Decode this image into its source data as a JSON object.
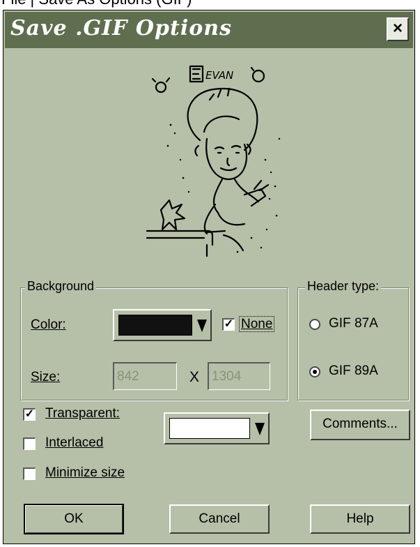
{
  "caption": "File | Save As Options (GIF)",
  "window": {
    "title": "Save .GIF Options",
    "close_glyph": "×"
  },
  "background": {
    "group_label": "Background",
    "color_label": "Color:",
    "color_value": "#111111",
    "none_label": "None",
    "none_checked": true,
    "size_label": "Size:",
    "width": "842",
    "size_separator": "X",
    "height": "1304"
  },
  "header_type": {
    "group_label": "Header type:",
    "option_87a": "GIF 87A",
    "option_89a": "GIF 89A",
    "selected": "GIF 89A"
  },
  "options": {
    "transparent_label": "Transparent:",
    "transparent_checked": true,
    "transparent_color": "#ffffff",
    "interlaced_label": "Interlaced",
    "interlaced_checked": false,
    "minimize_label": "Minimize size",
    "minimize_checked": false
  },
  "buttons": {
    "comments": "Comments...",
    "ok": "OK",
    "cancel": "Cancel",
    "help": "Help"
  },
  "preview": {
    "signature": "EVAN"
  },
  "icons": {
    "dropdown": "dropdown-arrow-icon",
    "check": "checkmark-icon",
    "close": "close-icon"
  },
  "colors": {
    "dialog_bg": "#b6c0a8",
    "titlebar_bg": "#5f6e4f"
  }
}
